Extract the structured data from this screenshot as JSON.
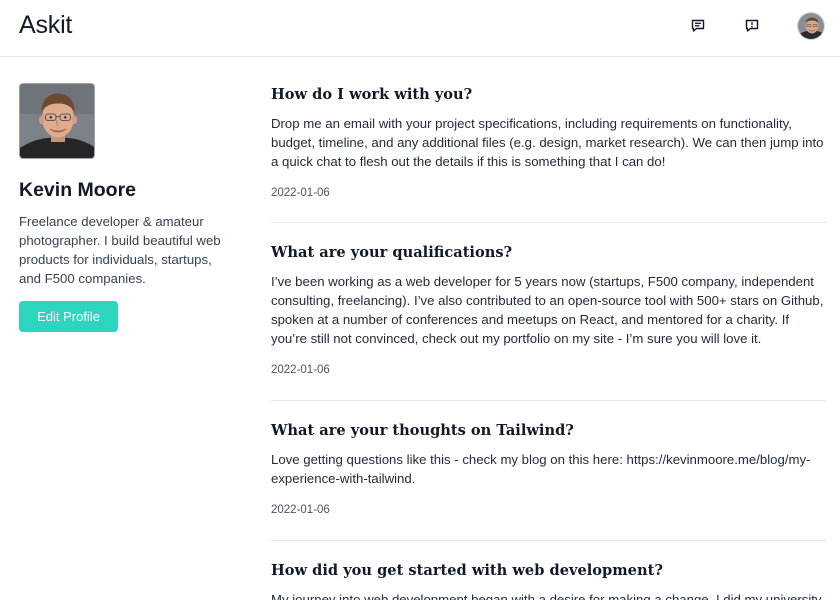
{
  "header": {
    "logo": "Askit",
    "icons": [
      "chat-icon",
      "chat-alert-icon"
    ]
  },
  "profile": {
    "name": "Kevin Moore",
    "bio": "Freelance developer & amateur photographer. I build beautiful web products for individuals, startups, and F500 companies.",
    "edit_label": "Edit Profile"
  },
  "questions": [
    {
      "question": "How do I work with you?",
      "answer": "Drop me an email with your project specifications, including requirements on functionality, budget, timeline, and any additional files (e.g. design, market research). We can then jump into a quick chat to flesh out the details if this is something that I can do!",
      "date": "2022-01-06"
    },
    {
      "question": "What are your qualifications?",
      "answer": "I’ve been working as a web developer for 5 years now (startups, F500 company, independent consulting, freelancing). I’ve also contributed to an open-source tool with 500+ stars on Github, spoken at a number of conferences and meetups on React, and mentored for a charity. If you’re still not convinced, check out my portfolio on my site - I’m sure you will love it.",
      "date": "2022-01-06"
    },
    {
      "question": "What are your thoughts on Tailwind?",
      "answer": "Love getting questions like this - check my blog on this here: https://kevinmoore.me/blog/my-experience-with-tailwind.",
      "date": "2022-01-06"
    },
    {
      "question": "How did you get started with web development?",
      "answer": "My journey into web development began with a desire for making a change. I did my university"
    }
  ],
  "colors": {
    "accent": "#2dd4bf",
    "divider": "#e5e7eb",
    "text": "#111827",
    "muted": "#4b5563"
  }
}
